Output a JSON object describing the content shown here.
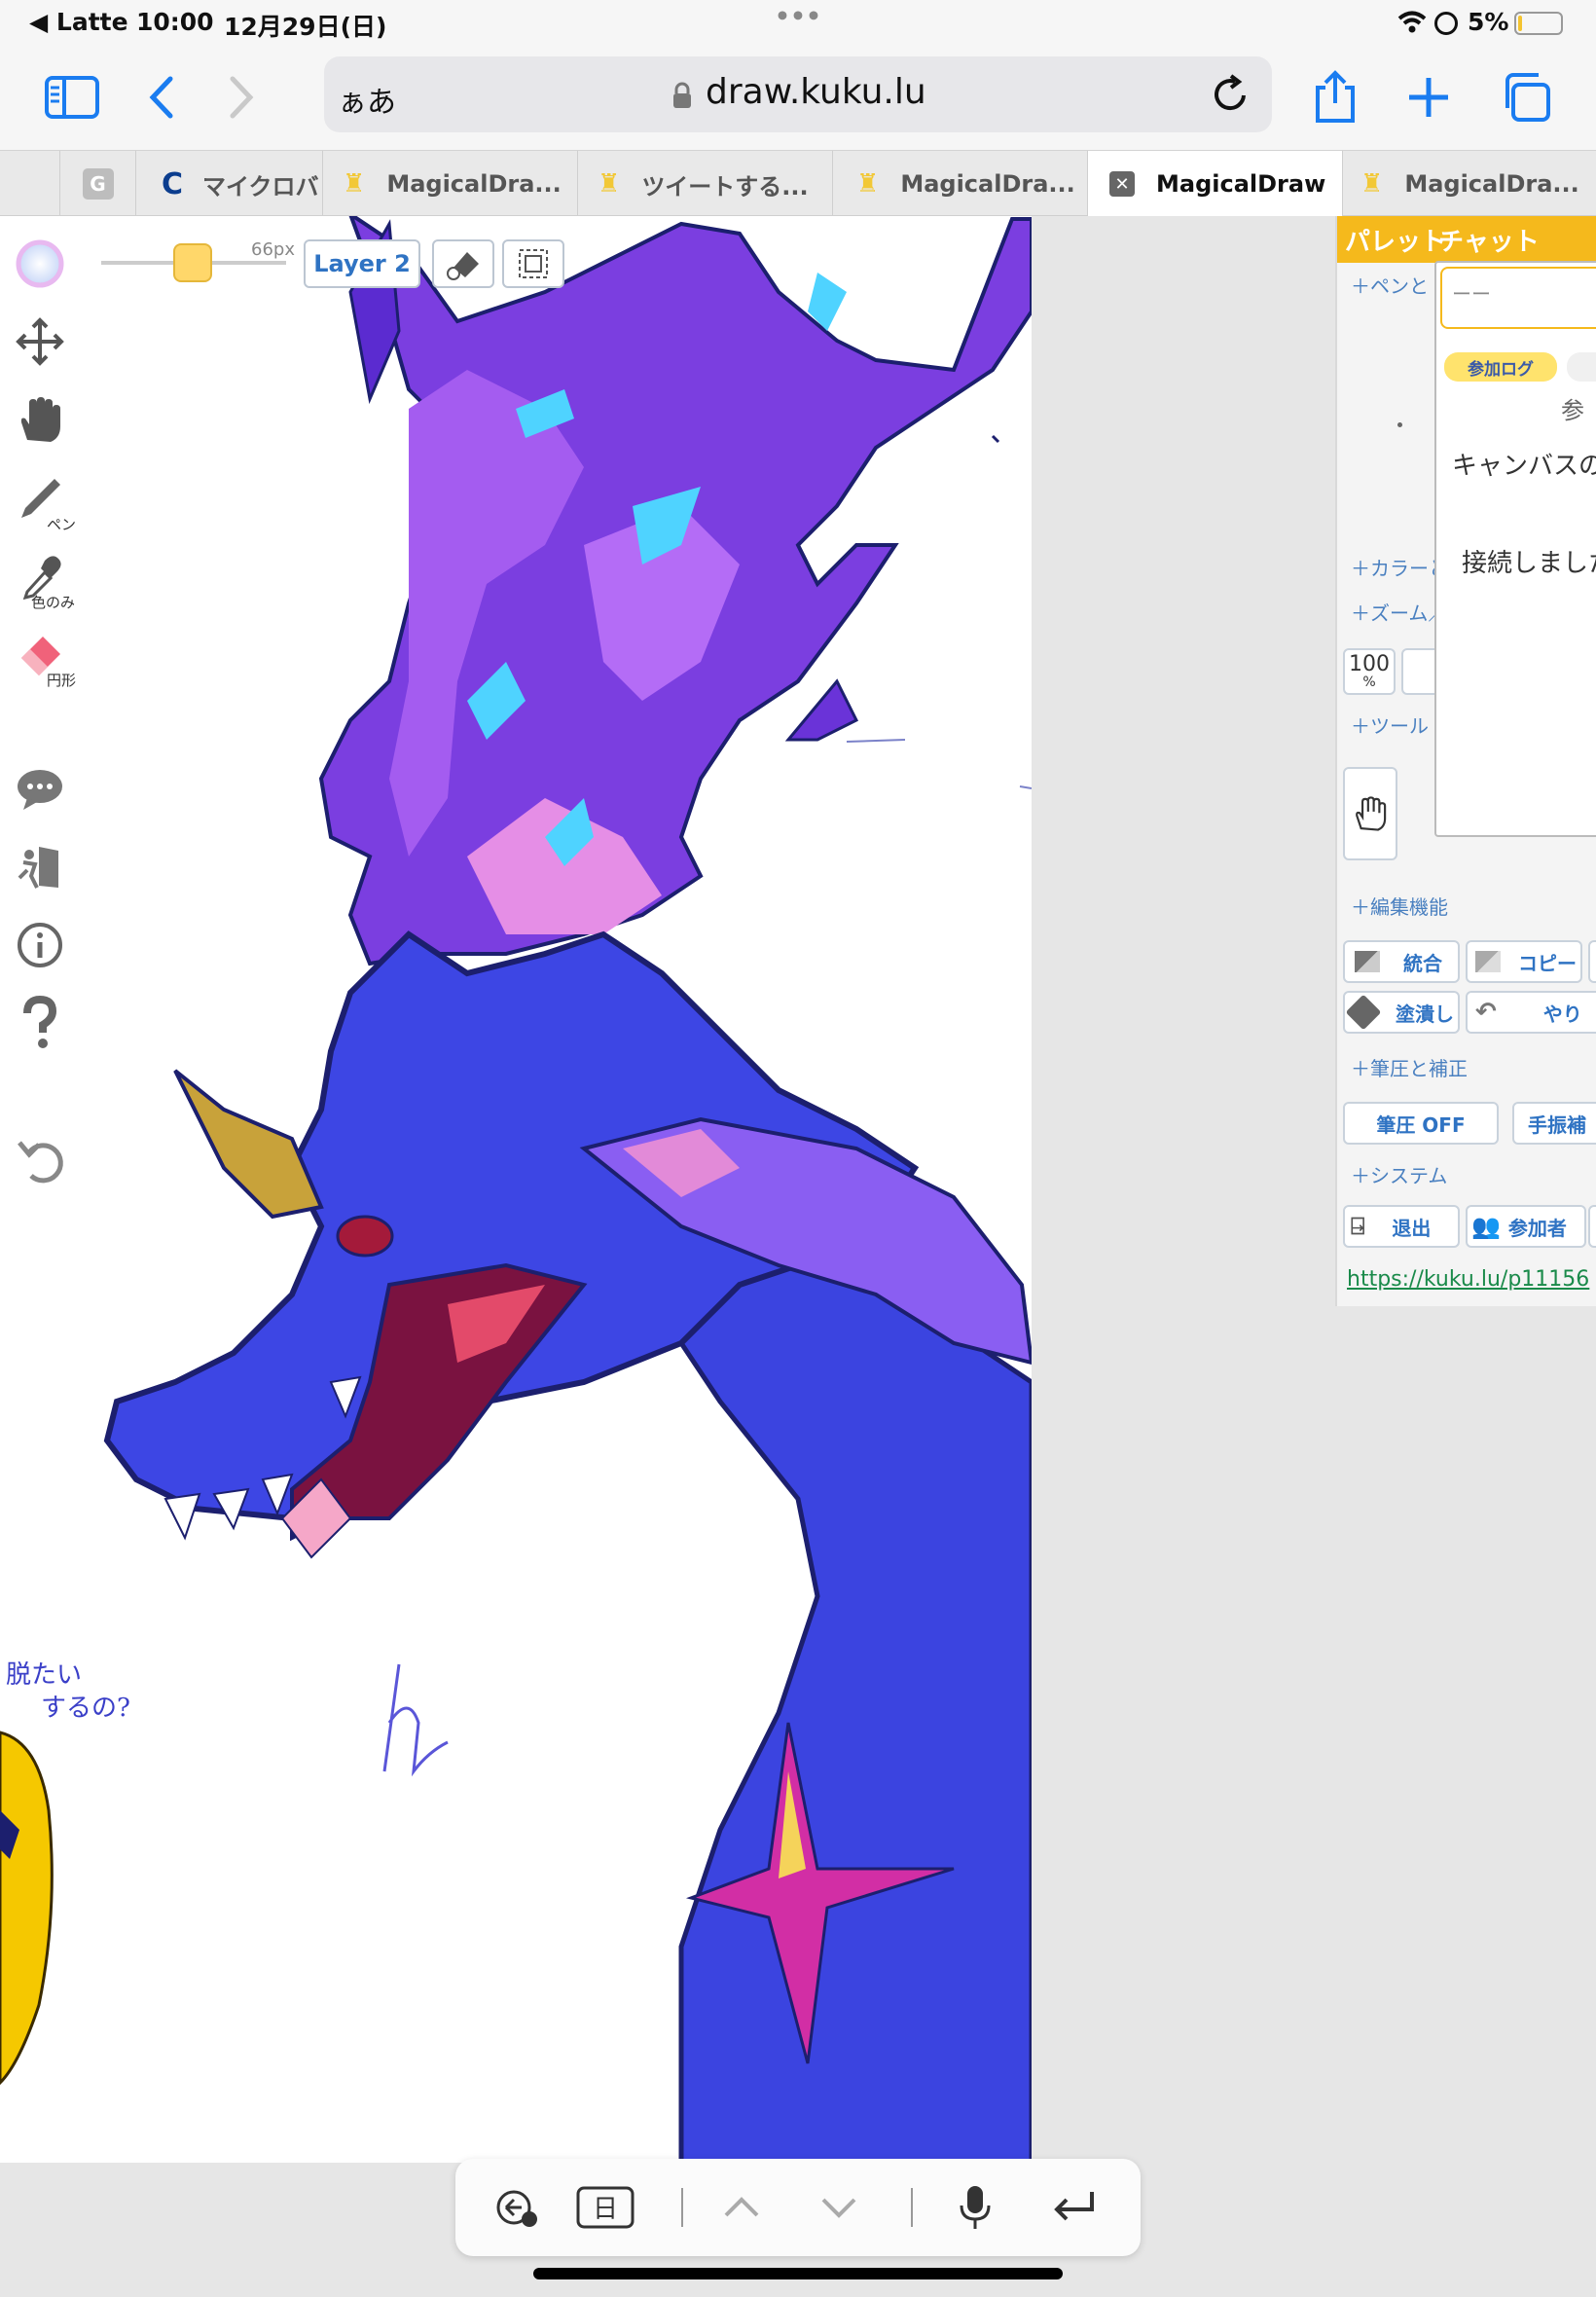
{
  "status": {
    "back_app": "◀ Latte",
    "time": "10:00",
    "date": "12月29日(日)",
    "battery": "5%",
    "dots": "•••"
  },
  "browser": {
    "aa": "ぁあ",
    "url": "draw.kuku.lu"
  },
  "tabs": [
    {
      "label": "マイクロバ"
    },
    {
      "label": "MagicalDra..."
    },
    {
      "label": "ツイートする..."
    },
    {
      "label": "MagicalDra..."
    },
    {
      "label": "MagicalDraw"
    },
    {
      "label": "MagicalDra..."
    }
  ],
  "toolbar": {
    "size": "66px",
    "layer": "Layer 2",
    "pen": "ペン",
    "dropper": "色のみ",
    "eraser": "円形"
  },
  "panel": {
    "title": "パレット",
    "chat_tab": "チャット",
    "pen_section": "＋ペンと",
    "color_section": "＋カラーと",
    "zoom_section": "＋ズーム／",
    "zoom_value": "100",
    "zoom_unit": "%",
    "tool_section": "＋ツール",
    "edit_section": "＋編集機能",
    "merge": "統合",
    "copy": "コピー",
    "fill": "塗潰し",
    "redo": "やり",
    "pressure_section": "＋筆圧と補正",
    "pressure_off": "筆圧 OFF",
    "stabilizer": "手振補",
    "system_section": "＋システム",
    "exit": "退出",
    "participants": "参加者",
    "link": "https://kuku.lu/p11156"
  },
  "chat": {
    "input": "ーー",
    "log_tab": "参加ログ",
    "text1": "参",
    "text2": "キャンバスの",
    "text3": "接続しました"
  },
  "canvas_text": {
    "handwritten_1": "脱たい",
    "handwritten_2": "するの?",
    "handwritten_3": "h"
  },
  "colors": {
    "accent": "#1a7cf0",
    "panel_header": "#f5b91c",
    "brush": "#ffd76a"
  }
}
